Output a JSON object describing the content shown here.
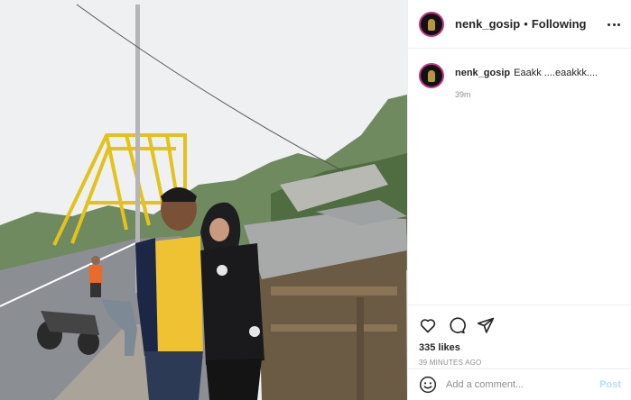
{
  "post": {
    "image_alt": "Photo of a couple near a yellow bridge",
    "colors": {
      "story_ring": "#c13584",
      "link_blue": "#b2dffc",
      "muted": "#8e8e8e"
    }
  },
  "header": {
    "username": "nenk_gosip",
    "separator": "•",
    "follow_status": "Following",
    "more_icon": "ellipsis-icon"
  },
  "caption": {
    "username": "nenk_gosip",
    "text": "Eaakk ....eaakkk....",
    "time": "39m"
  },
  "actions": {
    "icons": [
      "heart-icon",
      "comment-icon",
      "share-icon"
    ],
    "likes": "335 likes",
    "posted": "39 MINUTES AGO"
  },
  "comment": {
    "placeholder": "Add a comment...",
    "post_label": "Post",
    "emoji_icon": "smiley-icon"
  }
}
